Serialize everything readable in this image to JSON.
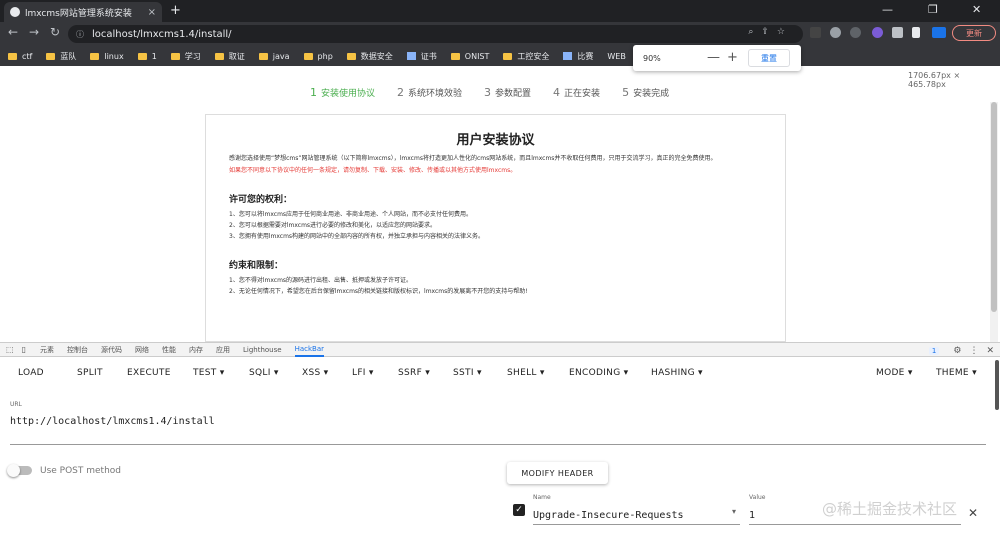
{
  "browser": {
    "tab_title": "lmxcms网站管理系统安装",
    "tab_close": "×",
    "new_tab": "+",
    "window_min": "—",
    "window_max": "❐",
    "window_close": "✕",
    "nav_back": "←",
    "nav_forward": "→",
    "nav_reload": "↻",
    "address": "localhost/lmxcms1.4/install/",
    "address_icons": "⌕⇪☆",
    "update_button": "更新",
    "bookmarks": [
      "ctf",
      "蓝队",
      "linux",
      "1",
      "学习",
      "取证",
      "java",
      "php",
      "数据安全",
      "证书",
      "ONIST",
      "工控安全",
      "比赛",
      "WEB"
    ],
    "bookmark_types": [
      "folder",
      "folder",
      "folder",
      "folder",
      "folder",
      "folder",
      "folder",
      "folder",
      "folder",
      "item",
      "folder",
      "folder",
      "item",
      "plain"
    ],
    "zoom": {
      "percent": "90%",
      "minus": "—",
      "plus": "+",
      "reset": "重置"
    },
    "viewport_dims": "1706.67px × 465.78px"
  },
  "page": {
    "steps": [
      {
        "num": "1",
        "label": "安装使用协议"
      },
      {
        "num": "2",
        "label": "系统环境效验"
      },
      {
        "num": "3",
        "label": "参数配置"
      },
      {
        "num": "4",
        "label": "正在安装"
      },
      {
        "num": "5",
        "label": "安装完成"
      }
    ],
    "active_step": 0,
    "agreement": {
      "title": "用户安装协议",
      "intro": "感谢您选择使用“梦想cms”网站管理系统（以下简称lmxcms），lmxcms将打造更加人性化的cms网站系统，而且lmxcms并不收取任何费用，只用于交流学习，真正的完全免费使用。",
      "warning": "如果您不同意以下协议中的任何一条规定，请勿复制、下载、安装、修改、传播或以其他方式使用lmxcms。",
      "rights_heading": "许可您的权利：",
      "rights": [
        "1、您可以将lmxcms应用于任何商业用途、非商业用途、个人网站，而不必支付任何费用。",
        "2、您可以根据需要对lmxcms进行必要的修改和美化，以适应您的网站要求。",
        "3、您拥有使用lmxcms构建的网站中的全部内容的所有权，并独立承担与内容相关的法律义务。"
      ],
      "limits_heading": "约束和限制：",
      "limits": [
        "1、您不得对lmxcms的源码进行出租、出售、抵押或发放子许可证。",
        "2、无论任何情况下，希望您在后台保留lmxcms的相关链接和版权标识，lmxcms的发展离不开您的支持与帮助!"
      ]
    },
    "accent_color": "#4caf50"
  },
  "devtools": {
    "tabs": [
      "元素",
      "控制台",
      "源代码",
      "网络",
      "性能",
      "内存",
      "应用",
      "Lighthouse",
      "HackBar"
    ],
    "active_tab": "HackBar",
    "message_count": "1",
    "gear": "⚙",
    "more": "⋮",
    "close": "✕"
  },
  "hackbar": {
    "menu": [
      "LOAD",
      "SPLIT",
      "EXECUTE",
      "TEST ▾",
      "SQLI ▾",
      "XSS ▾",
      "LFI ▾",
      "SSRF ▾",
      "SSTI ▾",
      "SHELL ▾",
      "ENCODING ▾",
      "HASHING ▾"
    ],
    "menu_right": [
      "MODE ▾",
      "THEME ▾"
    ],
    "url_label": "URL",
    "url_value": "http://localhost/lmxcms1.4/install",
    "post_label": "Use POST method",
    "post_enabled": false,
    "modify_header": "MODIFY HEADER",
    "header_name_label": "Name",
    "header_name_value": "Upgrade-Insecure-Requests",
    "header_value_label": "Value",
    "header_value_value": "1",
    "header_checked": true,
    "header_delete": "✕",
    "dropdown_arrow": "▾",
    "check_mark": "✓"
  },
  "watermark": "@稀土掘金技术社区"
}
